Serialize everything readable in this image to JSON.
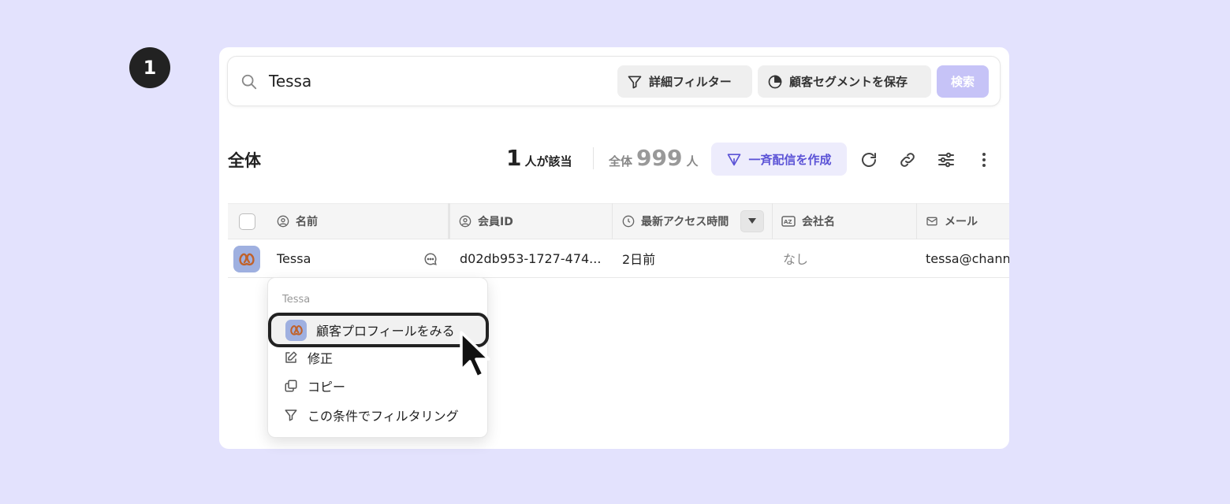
{
  "step_number": "1",
  "search": {
    "value": "Tessa",
    "filter_button": "詳細フィルター",
    "segment_button": "顧客セグメントを保存",
    "search_button": "検索"
  },
  "toolbar": {
    "title": "全体",
    "match_count": "1",
    "match_label": "人が該当",
    "total_label": "全体",
    "total_count": "999",
    "total_unit": "人",
    "broadcast_button": "一斉配信を作成"
  },
  "table": {
    "headers": {
      "name": "名前",
      "member_id": "会員ID",
      "last_access": "最新アクセス時間",
      "company": "会社名",
      "email": "メール"
    },
    "rows": [
      {
        "name": "Tessa",
        "member_id": "d02db953-1727-474...",
        "last_access": "2日前",
        "company": "なし",
        "email": "tessa@channel"
      }
    ]
  },
  "context_menu": {
    "header": "Tessa",
    "items": [
      {
        "label": "顧客プロフィールをみる",
        "icon": "avatar-icon"
      },
      {
        "label": "修正",
        "icon": "edit-icon"
      },
      {
        "label": "コピー",
        "icon": "copy-icon"
      },
      {
        "label": "この条件でフィルタリング",
        "icon": "filter-icon"
      }
    ]
  },
  "colors": {
    "background": "#e3e2fd",
    "accent": "#5b52d6",
    "accent_light": "#edecfc",
    "search_button_bg": "#c6c3f7",
    "avatar_bg": "#9fb0e0"
  }
}
